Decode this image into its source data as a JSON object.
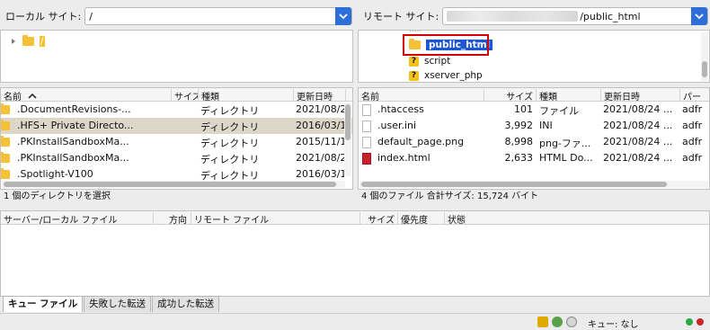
{
  "local_site": {
    "label": "ローカル サイト:",
    "path": "/"
  },
  "remote_site": {
    "label": "リモート サイト:",
    "path_suffix": "/public_html"
  },
  "local_tree": {
    "root_label": "/"
  },
  "remote_tree": {
    "items": [
      {
        "name": "public_html",
        "icon": "folder-icon",
        "selected": true
      },
      {
        "name": "script",
        "icon": "unknown-icon"
      },
      {
        "name": "xserver_php",
        "icon": "unknown-icon"
      }
    ]
  },
  "local_list": {
    "headers": [
      "名前",
      "サイズ",
      "種類",
      "更新日時"
    ],
    "rows": [
      {
        "name": ".DocumentRevisions-...",
        "type": "ディレクトリ",
        "modified": "2021/08/2"
      },
      {
        "name": ".HFS+ Private Directo...",
        "type": "ディレクトリ",
        "modified": "2016/03/1"
      },
      {
        "name": ".PKInstallSandboxMa...",
        "type": "ディレクトリ",
        "modified": "2015/11/1"
      },
      {
        "name": ".PKInstallSandboxMa...",
        "type": "ディレクトリ",
        "modified": "2021/08/2"
      },
      {
        "name": ".Spotlight-V100",
        "type": "ディレクトリ",
        "modified": "2016/03/1"
      }
    ],
    "status": "1 個のディレクトリを選択"
  },
  "remote_list": {
    "headers": [
      "名前",
      "サイズ",
      "種類",
      "更新日時",
      "パー"
    ],
    "rows": [
      {
        "name": ".htaccess",
        "size": "101",
        "type": "ファイル",
        "modified": "2021/08/24 ...",
        "perm": "adfr"
      },
      {
        "name": ".user.ini",
        "size": "3,992",
        "type": "INI",
        "modified": "2021/08/24 ...",
        "perm": "adfr"
      },
      {
        "name": "default_page.png",
        "size": "8,998",
        "type": "png-ファ...",
        "modified": "2021/08/24 ...",
        "perm": "adfr"
      },
      {
        "name": "index.html",
        "size": "2,633",
        "type": "HTML Do...",
        "modified": "2021/08/24 ...",
        "perm": "adfr"
      }
    ],
    "status": "4 個のファイル 合計サイズ: 15,724 バイト"
  },
  "queue": {
    "headers": [
      "サーバー/ローカル ファイル",
      "方向",
      "リモート ファイル",
      "サイズ",
      "優先度",
      "状態"
    ]
  },
  "tabs": [
    "キュー ファイル",
    "失敗した転送",
    "成功した転送"
  ],
  "statusbar": {
    "queue_text": "キュー: なし"
  },
  "colors": {
    "selection_blue": "#1a56d6",
    "highlight_red": "#d40000",
    "folder_yellow": "#f6c137"
  }
}
